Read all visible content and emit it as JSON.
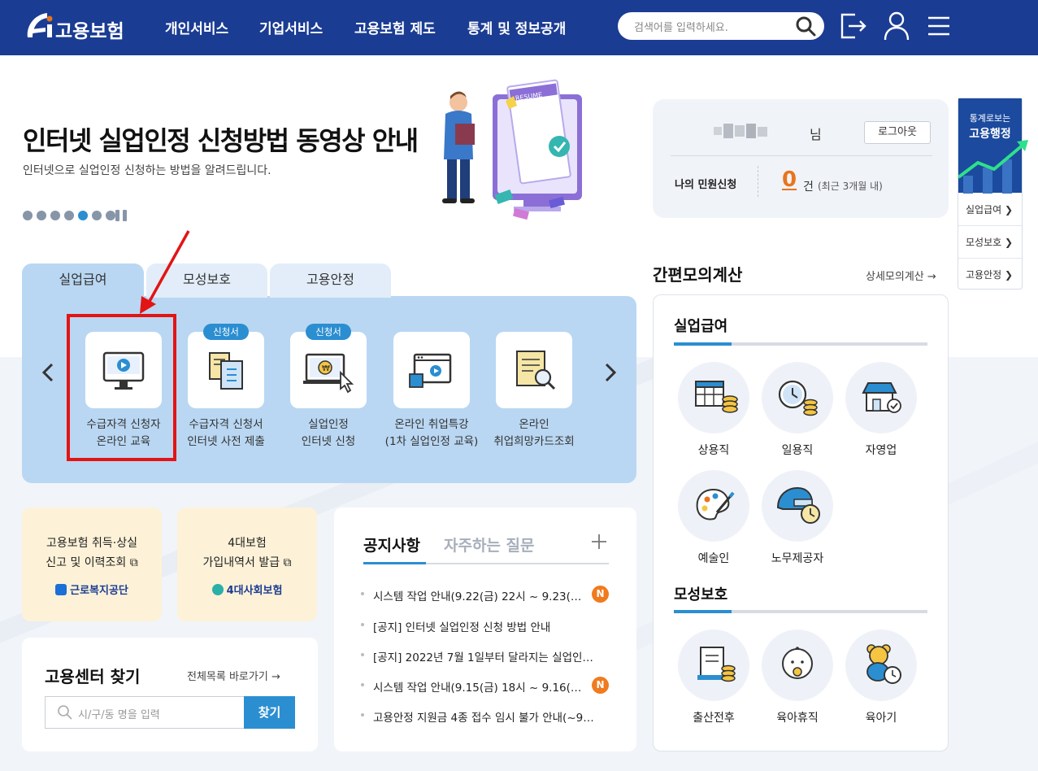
{
  "header": {
    "logo_text": "고용보험",
    "nav": [
      "개인서비스",
      "기업서비스",
      "고용보험 제도",
      "통계 및 정보공개"
    ],
    "search_placeholder": "검색어를 입력하세요."
  },
  "banner": {
    "title": "인터넷 실업인정 신청방법 동영상 안내",
    "subtitle": "인터넷으로 실업인정 신청하는 방법을 알려드립니다.",
    "slide_count": 7,
    "active_slide": 5,
    "illustration_label": "RESUME"
  },
  "login": {
    "suffix": "님",
    "logout_button": "로그아웃",
    "request_label": "나의 민원신청",
    "request_count": "0",
    "request_unit": "건",
    "request_note": "(최근 3개월 내)"
  },
  "stats_panel": {
    "title_line1": "통계로보는",
    "title_line2": "고용행정",
    "links": [
      "실업급여 ❯",
      "모성보호 ❯",
      "고용안정 ❯"
    ]
  },
  "service_tabs": {
    "tabs": [
      "실업급여",
      "모성보호",
      "고용안정"
    ],
    "active": "실업급여",
    "items": [
      {
        "line1": "수급자격 신청자",
        "line2": "온라인 교육",
        "badge": "",
        "icon": "monitor-play-icon"
      },
      {
        "line1": "수급자격 신청서",
        "line2": "인터넷 사전 제출",
        "badge": "신청서",
        "icon": "documents-icon"
      },
      {
        "line1": "실업인정",
        "line2": "인터넷 신청",
        "badge": "신청서",
        "icon": "monitor-won-click-icon"
      },
      {
        "line1": "온라인 취업특강",
        "line2": "(1차 실업인정 교육)",
        "badge": "",
        "icon": "browser-video-icon"
      },
      {
        "line1": "온라인",
        "line2": "취업희망카드조회",
        "badge": "",
        "icon": "card-search-icon"
      }
    ]
  },
  "quick_cards": [
    {
      "line1": "고용보험 취득·상실",
      "line2": "신고 및 이력조회 ⧉",
      "org": "근로복지공단"
    },
    {
      "line1": "4대보험",
      "line2": "가입내역서 발급 ⧉",
      "org": "4대사회보험"
    }
  ],
  "center_finder": {
    "title": "고용센터 찾기",
    "link": "전체목록 바로가기 →",
    "placeholder": "시/구/동 명을 입력",
    "button": "찾기"
  },
  "notices": {
    "tab_active": "공지사항",
    "tab_inactive": "자주하는 질문",
    "items": [
      {
        "text": "시스템 작업 안내(9.22(금) 22시 ~ 9.23(…",
        "new": "N"
      },
      {
        "text": "[공지] 인터넷 실업인정 신청 방법 안내",
        "new": ""
      },
      {
        "text": "[공지] 2022년 7월 1일부터 달라지는 실업인…",
        "new": ""
      },
      {
        "text": "시스템 작업 안내(9.15(금) 18시 ~ 9.16(…",
        "new": "N"
      },
      {
        "text": "고용안정 지원금 4종 접수 임시 불가 안내(~9…",
        "new": ""
      }
    ]
  },
  "calculator": {
    "title": "간편모의계산",
    "link": "상세모의계산 →",
    "sections": [
      {
        "title": "실업급여",
        "items": [
          "상용직",
          "일용직",
          "자영업",
          "예술인",
          "노무제공자"
        ]
      },
      {
        "title": "모성보호",
        "items": [
          "출산전후",
          "육아휴직",
          "육아기"
        ]
      }
    ]
  },
  "colors": {
    "header": "#1b3c93",
    "accent": "#2b8ed1",
    "highlight": "#e31414",
    "orange": "#e8741c"
  }
}
